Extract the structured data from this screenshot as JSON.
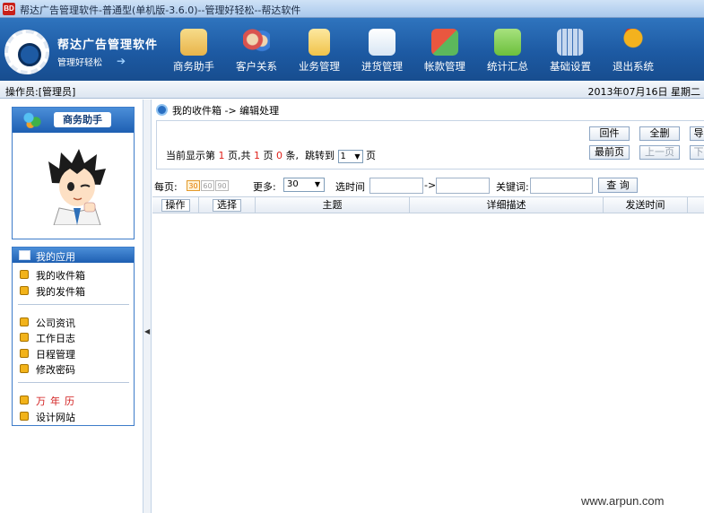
{
  "window": {
    "title": "帮达广告管理软件-普通型(单机版-3.6.0)--管理好轻松--帮达软件",
    "app_icon_text": "BD"
  },
  "brand": {
    "name": "帮达广告管理软件",
    "slogan": "管理好轻松"
  },
  "nav": [
    {
      "label": "商务助手",
      "icon": "clipboard-pen-icon",
      "color": "#e8b44a"
    },
    {
      "label": "客户关系",
      "icon": "people-icon",
      "color": "#d9534f"
    },
    {
      "label": "业务管理",
      "icon": "clipboard-icon",
      "color": "#f0c34a"
    },
    {
      "label": "进货管理",
      "icon": "notepad-pen-icon",
      "color": "#d8e6f4"
    },
    {
      "label": "帐款管理",
      "icon": "transfer-arrows-icon",
      "color": "#e9573f"
    },
    {
      "label": "统计汇总",
      "icon": "chart-icon",
      "color": "#6cbf3c"
    },
    {
      "label": "基础设置",
      "icon": "calendar-grid-icon",
      "color": "#c6d8ef"
    },
    {
      "label": "退出系统",
      "icon": "exit-figure-icon",
      "color": "#f3b21e"
    }
  ],
  "infobar": {
    "operator": "操作员:[管理员]",
    "date": "2013年07月16日 星期二"
  },
  "assistant": {
    "title": "商务助手"
  },
  "apps": {
    "title": "我的应用",
    "group1": [
      "我的收件箱",
      "我的发件箱"
    ],
    "group2": [
      "公司资讯",
      "工作日志",
      "日程管理",
      "修改密码"
    ],
    "group3_red": "万年历",
    "group3": [
      "设计网站"
    ]
  },
  "breadcrumb": "我的收件箱 -> 编辑处理",
  "pager": {
    "prefix": "当前显示第",
    "current": "1",
    "mid1": "页,共",
    "total_pages": "1",
    "mid2": "页",
    "total_items": "0",
    "mid3": "条,",
    "jump": "跳转到",
    "jump_value": "1",
    "suffix": "页",
    "buttons_top": [
      "回件",
      "全删",
      "导"
    ],
    "buttons_bottom": [
      "最前页",
      "上一页",
      "下"
    ]
  },
  "filter": {
    "per_page_label": "每页:",
    "per_page_options": [
      "30",
      "60",
      "90"
    ],
    "more_label": "更多:",
    "more_value": "30",
    "time_label": "选时间",
    "arrow": "->",
    "keyword_label": "关键词:",
    "query_button": "查 询"
  },
  "grid": {
    "columns": [
      "操作",
      "选择",
      "主题",
      "详细描述",
      "发送时间"
    ]
  },
  "watermark": "www.arpun.com"
}
